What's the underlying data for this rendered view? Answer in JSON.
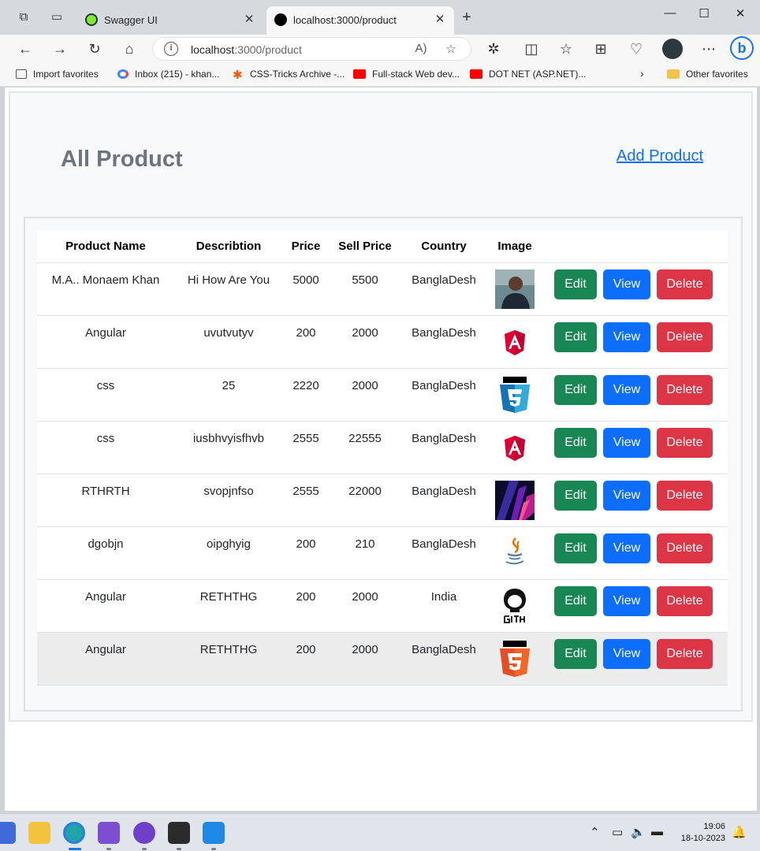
{
  "browser": {
    "tabs": [
      {
        "title": "Swagger UI",
        "active": false
      },
      {
        "title": "localhost:3000/product",
        "active": true
      }
    ],
    "url_host": "localhost",
    "url_rest": ":3000/product",
    "favorites": [
      {
        "label": "Import favorites"
      },
      {
        "label": "Inbox (215) - khan..."
      },
      {
        "label": "CSS-Tricks Archive -..."
      },
      {
        "label": "Full-stack Web dev..."
      },
      {
        "label": "DOT NET (ASP.NET)..."
      },
      {
        "label": "Other favorites"
      }
    ]
  },
  "page": {
    "title": "All Product",
    "add_link": "Add Product"
  },
  "table": {
    "headers": [
      "Product Name",
      "Describtion",
      "Price",
      "Sell Price",
      "Country",
      "Image"
    ],
    "actions": {
      "edit": "Edit",
      "view": "View",
      "delete": "Delete"
    },
    "rows": [
      {
        "name": "M.A.. Monaem Khan",
        "description": "Hi How Are You",
        "price": "5000",
        "sell_price": "5500",
        "country": "BanglaDesh",
        "image": "person-photo"
      },
      {
        "name": "Angular",
        "description": "uvutvutyv",
        "price": "200",
        "sell_price": "2000",
        "country": "BanglaDesh",
        "image": "angular-logo"
      },
      {
        "name": "css",
        "description": "25",
        "price": "2220",
        "sell_price": "2000",
        "country": "BanglaDesh",
        "image": "css3-logo"
      },
      {
        "name": "css",
        "description": "iusbhvyisfhvb",
        "price": "2555",
        "sell_price": "22555",
        "country": "BanglaDesh",
        "image": "angular-logo"
      },
      {
        "name": "RTHRTH",
        "description": "svopjnfso",
        "price": "2555",
        "sell_price": "22000",
        "country": "BanglaDesh",
        "image": "abstract-wallpaper"
      },
      {
        "name": "dgobjn",
        "description": "oipghyig",
        "price": "200",
        "sell_price": "210",
        "country": "BanglaDesh",
        "image": "java-logo"
      },
      {
        "name": "Angular",
        "description": "RETHTHG",
        "price": "200",
        "sell_price": "2000",
        "country": "India",
        "image": "github-logo"
      },
      {
        "name": "Angular",
        "description": "RETHTHG",
        "price": "200",
        "sell_price": "2000",
        "country": "BanglaDesh",
        "image": "html5-logo"
      }
    ]
  },
  "taskbar": {
    "time": "19:06",
    "date": "18-10-2023"
  },
  "colors": {
    "edit": "#198754",
    "view": "#0d6efd",
    "delete": "#dc3545",
    "title": "#6c757d"
  }
}
